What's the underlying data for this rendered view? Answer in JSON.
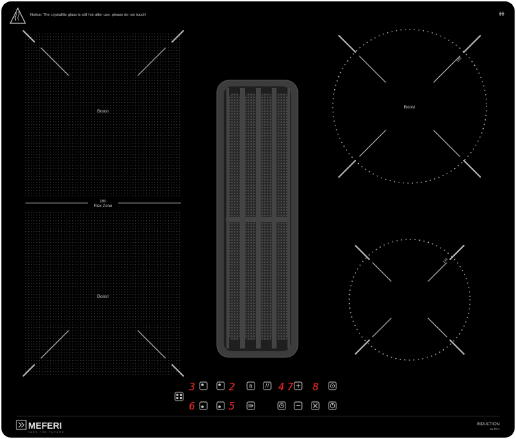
{
  "notice": "Notice: The crystallite glass is still hot after use, please do not touch!",
  "zones": {
    "flex_upper": {
      "label": "Boost"
    },
    "flex_lower": {
      "label": "Boost"
    },
    "flex_divider": {
      "size": "180",
      "label": "Flex Zone"
    },
    "rear_right": {
      "label": "Boost",
      "size": "180"
    },
    "front_right": {
      "size": "140"
    }
  },
  "controls": {
    "top_row": [
      {
        "digit": "3",
        "button_icon": "dot-top-left-icon"
      },
      {
        "digit": "2",
        "button_icon": "dot-top-left-icon"
      },
      {
        "digit": "",
        "button_icon": "boost-b-icon",
        "button_text": "B"
      },
      {
        "digit": "",
        "button_icon": "vent-level-icon"
      },
      {
        "digit": "4",
        "button_icon": "vent-level-icon"
      },
      {
        "digit": "7",
        "button_icon": "plus-icon"
      },
      {
        "digit": "8",
        "button_icon": "fan-icon"
      }
    ],
    "bottom_row": [
      {
        "digit": "6",
        "button_icon": "dot-bottom-left-icon"
      },
      {
        "digit": "5",
        "button_icon": "dot-bottom-right-icon"
      },
      {
        "button_icon": "play-pause-icon"
      },
      {
        "button_icon": "timer-icon"
      },
      {
        "button_icon": "minus-icon"
      },
      {
        "button_icon": "lock-x-icon"
      },
      {
        "button_icon": "power-icon"
      }
    ],
    "display_color": "#ff2a2a"
  },
  "brand": {
    "name": "MEFERI",
    "tagline": "TAKE THE FUTURE",
    "series": "INDUCTION",
    "series_sub": "ULTRA"
  },
  "colors": {
    "glass": "#000000",
    "marking": "#bdbdbd",
    "digit": "#ff2a2a"
  }
}
